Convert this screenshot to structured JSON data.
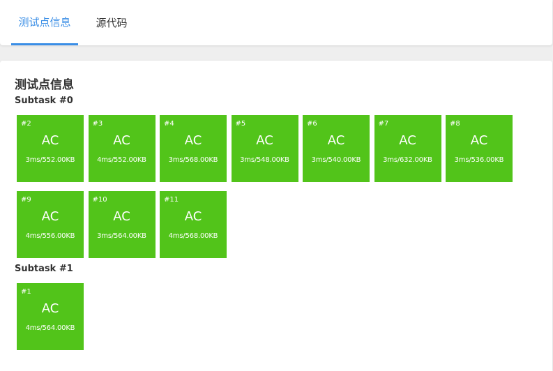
{
  "tabs": [
    {
      "label": "测试点信息",
      "active": true
    },
    {
      "label": "源代码",
      "active": false
    }
  ],
  "section_title": "测试点信息",
  "subtasks": [
    {
      "title": "Subtask #0",
      "cases": [
        {
          "id": "#2",
          "status": "AC",
          "meta": "3ms/552.00KB"
        },
        {
          "id": "#3",
          "status": "AC",
          "meta": "4ms/552.00KB"
        },
        {
          "id": "#4",
          "status": "AC",
          "meta": "3ms/568.00KB"
        },
        {
          "id": "#5",
          "status": "AC",
          "meta": "3ms/548.00KB"
        },
        {
          "id": "#6",
          "status": "AC",
          "meta": "3ms/540.00KB"
        },
        {
          "id": "#7",
          "status": "AC",
          "meta": "3ms/632.00KB"
        },
        {
          "id": "#8",
          "status": "AC",
          "meta": "3ms/536.00KB"
        },
        {
          "id": "#9",
          "status": "AC",
          "meta": "4ms/556.00KB"
        },
        {
          "id": "#10",
          "status": "AC",
          "meta": "3ms/564.00KB"
        },
        {
          "id": "#11",
          "status": "AC",
          "meta": "4ms/568.00KB"
        }
      ]
    },
    {
      "title": "Subtask #1",
      "cases": [
        {
          "id": "#1",
          "status": "AC",
          "meta": "4ms/564.00KB"
        }
      ]
    }
  ],
  "colors": {
    "accent": "#3a8ee6",
    "ac": "#52c41a"
  }
}
